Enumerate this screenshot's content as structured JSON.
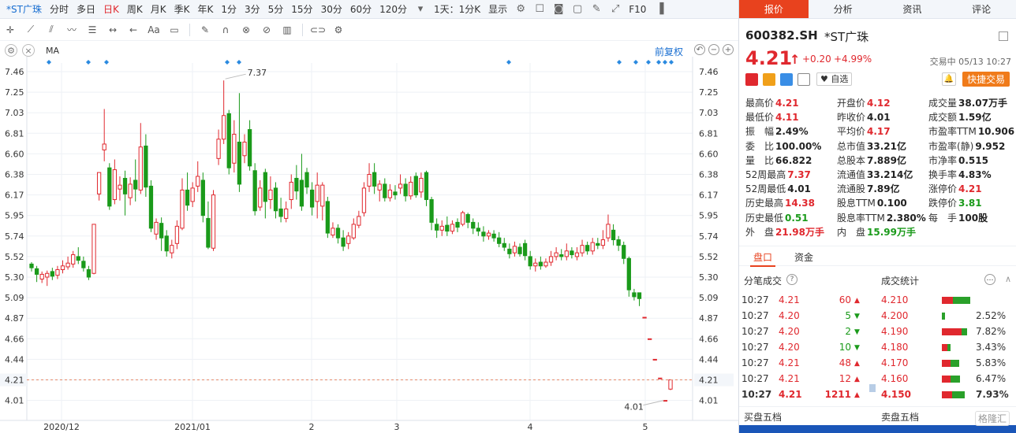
{
  "toolbar": {
    "stock": "*ST广珠",
    "periods": [
      "分时",
      "多日",
      "日K",
      "周K",
      "月K",
      "季K",
      "年K",
      "1分",
      "3分",
      "5分",
      "15分",
      "30分",
      "60分",
      "120分"
    ],
    "active_period": "日K",
    "multi": "1天：1分K",
    "display": "显示",
    "right_label": "F10"
  },
  "drawbar": {
    "ma_label": "MA",
    "adjust": "前复权",
    "text_tool": "Aa"
  },
  "chart_data": {
    "type": "candlestick",
    "y_ticks": [
      7.46,
      7.25,
      7.03,
      6.81,
      6.6,
      6.38,
      6.17,
      5.95,
      5.74,
      5.52,
      5.3,
      5.09,
      4.87,
      4.66,
      4.44,
      4.21,
      4.01
    ],
    "x_labels": [
      "2020/12",
      "2021/01",
      "2",
      "3",
      "4",
      "5"
    ],
    "current_price": "4.21",
    "high_label": "7.37",
    "low_label": "4.01",
    "ylim": [
      3.95,
      7.5
    ],
    "candles": [
      [
        5.44,
        5.4,
        5.46,
        5.36
      ],
      [
        5.39,
        5.33,
        5.42,
        5.25
      ],
      [
        5.28,
        5.33,
        5.36,
        5.24
      ],
      [
        5.3,
        5.34,
        5.37,
        5.21
      ],
      [
        5.36,
        5.31,
        5.4,
        5.27
      ],
      [
        5.32,
        5.38,
        5.42,
        5.28
      ],
      [
        5.38,
        5.42,
        5.48,
        5.34
      ],
      [
        5.41,
        5.45,
        5.52,
        5.38
      ],
      [
        5.44,
        5.54,
        5.58,
        5.4
      ],
      [
        5.52,
        5.48,
        5.62,
        5.44
      ],
      [
        5.47,
        5.4,
        5.52,
        5.36
      ],
      [
        5.38,
        5.3,
        5.42,
        5.27
      ],
      [
        5.34,
        5.86,
        5.86,
        5.33
      ],
      [
        6.18,
        6.4,
        6.4,
        6.11
      ],
      [
        6.64,
        6.7,
        7.07,
        6.52
      ],
      [
        6.45,
        6.05,
        6.5,
        6.01
      ],
      [
        6.12,
        6.43,
        6.54,
        6.07
      ],
      [
        6.23,
        6.27,
        6.36,
        6.11
      ],
      [
        6.34,
        6.18,
        6.42,
        5.95
      ],
      [
        6.14,
        6.28,
        6.35,
        6.06
      ],
      [
        6.32,
        6.23,
        6.54,
        6.1
      ],
      [
        6.22,
        6.67,
        6.92,
        6.18
      ],
      [
        6.68,
        6.25,
        6.8,
        6.15
      ],
      [
        6.26,
        5.82,
        6.32,
        5.78
      ],
      [
        5.76,
        5.88,
        5.92,
        5.7
      ],
      [
        5.87,
        5.72,
        5.93,
        5.58
      ],
      [
        5.74,
        5.58,
        5.8,
        5.52
      ],
      [
        5.56,
        5.64,
        5.7,
        5.5
      ],
      [
        5.66,
        5.84,
        5.9,
        5.6
      ],
      [
        5.82,
        6.22,
        6.34,
        5.8
      ],
      [
        6.22,
        6.06,
        6.4,
        6.0
      ],
      [
        6.1,
        6.24,
        6.3,
        6.04
      ],
      [
        6.26,
        6.36,
        6.52,
        6.2
      ],
      [
        6.32,
        5.95,
        6.4,
        5.88
      ],
      [
        5.92,
        5.62,
        6.1,
        5.6
      ],
      [
        5.61,
        6.17,
        6.22,
        5.58
      ],
      [
        6.55,
        6.75,
        6.85,
        6.48
      ],
      [
        6.75,
        7.0,
        7.37,
        6.7
      ],
      [
        7.02,
        6.45,
        7.06,
        6.38
      ],
      [
        6.5,
        6.8,
        6.95,
        6.4
      ],
      [
        6.72,
        6.28,
        7.24,
        6.2
      ],
      [
        6.58,
        6.72,
        6.8,
        6.5
      ],
      [
        6.85,
        6.47,
        6.95,
        6.42
      ],
      [
        6.42,
        6.0,
        6.5,
        5.95
      ],
      [
        6.04,
        6.24,
        6.32,
        6.0
      ],
      [
        6.4,
        6.1,
        6.44,
        5.92
      ],
      [
        6.12,
        6.22,
        6.36,
        6.02
      ],
      [
        6.24,
        6.0,
        6.3,
        5.92
      ],
      [
        6.02,
        5.94,
        6.14,
        5.88
      ],
      [
        5.92,
        6.02,
        6.1,
        5.88
      ],
      [
        6.12,
        6.3,
        6.38,
        6.02
      ],
      [
        6.34,
        6.21,
        6.48,
        6.12
      ],
      [
        6.32,
        6.05,
        6.6,
        6.0
      ],
      [
        6.4,
        6.25,
        6.45,
        6.18
      ],
      [
        6.22,
        6.04,
        6.3,
        5.95
      ],
      [
        6.1,
        6.27,
        6.4,
        5.92
      ],
      [
        6.05,
        6.27,
        6.3,
        5.9
      ],
      [
        6.1,
        5.77,
        6.15,
        5.72
      ],
      [
        5.75,
        5.82,
        5.88,
        5.72
      ],
      [
        5.82,
        5.72,
        5.86,
        5.66
      ],
      [
        5.72,
        5.63,
        5.8,
        5.58
      ],
      [
        5.66,
        5.74,
        5.78,
        5.6
      ],
      [
        5.72,
        5.86,
        5.92,
        5.7
      ],
      [
        5.85,
        5.94,
        6.0,
        5.82
      ],
      [
        5.98,
        6.24,
        6.3,
        5.94
      ],
      [
        6.26,
        6.38,
        6.5,
        6.2
      ],
      [
        6.4,
        6.26,
        6.5,
        6.18
      ],
      [
        6.22,
        6.28,
        6.32,
        6.1
      ],
      [
        6.28,
        6.14,
        6.34,
        6.1
      ],
      [
        6.14,
        6.22,
        6.28,
        6.1
      ],
      [
        6.2,
        6.17,
        6.27,
        6.12
      ],
      [
        6.24,
        6.28,
        6.38,
        6.18
      ],
      [
        6.28,
        6.16,
        6.34,
        6.1
      ],
      [
        6.16,
        6.3,
        6.36,
        6.12
      ],
      [
        6.36,
        6.17,
        6.4,
        6.14
      ],
      [
        6.2,
        6.34,
        6.4,
        6.14
      ],
      [
        6.4,
        6.12,
        6.42,
        6.05
      ],
      [
        6.12,
        5.88,
        6.15,
        5.8
      ],
      [
        5.86,
        5.8,
        5.92,
        5.72
      ],
      [
        5.8,
        5.84,
        5.9,
        5.74
      ],
      [
        5.85,
        5.79,
        5.94,
        5.74
      ],
      [
        5.79,
        5.86,
        5.9,
        5.76
      ],
      [
        5.88,
        5.83,
        5.92,
        5.78
      ],
      [
        5.86,
        5.98,
        6.0,
        5.84
      ],
      [
        5.96,
        5.88,
        5.98,
        5.82
      ],
      [
        5.88,
        5.82,
        5.92,
        5.76
      ],
      [
        5.82,
        5.79,
        5.88,
        5.74
      ],
      [
        5.78,
        5.74,
        5.84,
        5.68
      ],
      [
        5.74,
        5.77,
        5.8,
        5.7
      ],
      [
        5.76,
        5.72,
        5.8,
        5.68
      ],
      [
        5.72,
        5.66,
        5.78,
        5.62
      ],
      [
        5.66,
        5.62,
        5.72,
        5.58
      ],
      [
        5.6,
        5.55,
        5.66,
        5.5
      ],
      [
        5.56,
        5.63,
        5.68,
        5.52
      ],
      [
        5.62,
        5.55,
        5.66,
        5.52
      ],
      [
        5.66,
        5.53,
        5.7,
        5.48
      ],
      [
        5.52,
        5.42,
        5.58,
        5.38
      ],
      [
        5.42,
        5.45,
        5.5,
        5.36
      ],
      [
        5.46,
        5.42,
        5.52,
        5.38
      ],
      [
        5.42,
        5.46,
        5.5,
        5.4
      ],
      [
        5.46,
        5.52,
        5.58,
        5.42
      ],
      [
        5.52,
        5.56,
        5.62,
        5.48
      ],
      [
        5.54,
        5.52,
        5.6,
        5.48
      ],
      [
        5.52,
        5.58,
        5.66,
        5.48
      ],
      [
        5.58,
        5.54,
        5.62,
        5.5
      ],
      [
        5.52,
        5.56,
        5.62,
        5.48
      ],
      [
        5.56,
        5.64,
        5.7,
        5.52
      ],
      [
        5.64,
        5.58,
        5.68,
        5.54
      ],
      [
        5.58,
        5.67,
        5.72,
        5.54
      ],
      [
        5.66,
        5.64,
        5.72,
        5.6
      ],
      [
        5.64,
        5.7,
        5.8,
        5.6
      ],
      [
        5.72,
        5.86,
        5.96,
        5.68
      ],
      [
        5.8,
        5.7,
        5.86,
        5.64
      ],
      [
        5.7,
        5.64,
        5.74,
        5.58
      ],
      [
        5.64,
        5.5,
        5.68,
        5.44
      ],
      [
        5.5,
        5.17,
        5.52,
        5.1
      ],
      [
        5.14,
        5.1,
        5.18,
        5.06
      ],
      [
        5.14,
        5.08,
        5.14,
        5.0
      ],
      [
        4.88,
        4.88,
        4.88,
        4.88
      ],
      [
        4.66,
        4.66,
        4.66,
        4.66
      ],
      [
        4.44,
        4.44,
        4.44,
        4.44
      ],
      [
        4.23,
        4.23,
        4.23,
        4.23
      ],
      [
        4.01,
        4.01,
        4.01,
        4.01
      ],
      [
        4.12,
        4.21,
        4.21,
        4.11
      ]
    ]
  },
  "quote": {
    "code": "600382.SH",
    "name": "*ST广珠",
    "price": "4.21",
    "change": "+0.20",
    "change_pct": "+4.99%",
    "trade_status": "交易中 05/13 10:27",
    "fav_label": "自选",
    "fast_trade": "快捷交易"
  },
  "tabs": [
    "报价",
    "分析",
    "资讯",
    "评论"
  ],
  "stats": [
    [
      {
        "l": "最高价",
        "v": "4.21",
        "c": "red"
      },
      {
        "l": "开盘价",
        "v": "4.12",
        "c": "red"
      },
      {
        "l": "成交量",
        "v": "38.07万手",
        "c": "dark"
      }
    ],
    [
      {
        "l": "最低价",
        "v": "4.11",
        "c": "red"
      },
      {
        "l": "昨收价",
        "v": "4.01",
        "c": "dark"
      },
      {
        "l": "成交额",
        "v": "1.59亿",
        "c": "dark"
      }
    ],
    [
      {
        "l": "振　幅",
        "v": "2.49%",
        "c": "dark"
      },
      {
        "l": "平均价",
        "v": "4.17",
        "c": "red"
      },
      {
        "l": "市盈率TTM",
        "v": "10.906",
        "c": "dark"
      }
    ],
    [
      {
        "l": "委　比",
        "v": "100.00%",
        "c": "dark"
      },
      {
        "l": "总市值",
        "v": "33.21亿",
        "c": "dark"
      },
      {
        "l": "市盈率(静)",
        "v": "9.952",
        "c": "dark"
      }
    ],
    [
      {
        "l": "量　比",
        "v": "66.822",
        "c": "dark"
      },
      {
        "l": "总股本",
        "v": "7.889亿",
        "c": "dark"
      },
      {
        "l": "市净率",
        "v": "0.515",
        "c": "dark"
      }
    ],
    [
      {
        "l": "52周最高",
        "v": "7.37",
        "c": "red"
      },
      {
        "l": "流通值",
        "v": "33.214亿",
        "c": "dark"
      },
      {
        "l": "换手率",
        "v": "4.83%",
        "c": "dark"
      }
    ],
    [
      {
        "l": "52周最低",
        "v": "4.01",
        "c": "dark"
      },
      {
        "l": "流通股",
        "v": "7.89亿",
        "c": "dark"
      },
      {
        "l": "涨停价",
        "v": "4.21",
        "c": "red"
      }
    ],
    [
      {
        "l": "历史最高",
        "v": "14.38",
        "c": "red"
      },
      {
        "l": "股息TTM",
        "v": "0.100",
        "c": "dark"
      },
      {
        "l": "跌停价",
        "v": "3.81",
        "c": "green"
      }
    ],
    [
      {
        "l": "历史最低",
        "v": "0.51",
        "c": "green"
      },
      {
        "l": "股息率TTM",
        "v": "2.380%",
        "c": "dark"
      },
      {
        "l": "每　手",
        "v": "100股",
        "c": "dark"
      }
    ],
    [
      {
        "l": "外　盘",
        "v": "21.98万手",
        "c": "red"
      },
      {
        "l": "内　盘",
        "v": "15.99万手",
        "c": "green"
      },
      {
        "l": "",
        "v": "",
        "c": "dark"
      }
    ]
  ],
  "subtabs": [
    "盘口",
    "资金"
  ],
  "tick_header": "分笔成交",
  "stat_header": "成交统计",
  "trades": [
    {
      "t": "10:27",
      "p": "4.21",
      "pc": "red",
      "v": "60",
      "dir": "up",
      "bp": "4.210",
      "pct": "",
      "r": 0.4,
      "g": 0.6
    },
    {
      "t": "10:27",
      "p": "4.20",
      "pc": "red",
      "v": "5",
      "dir": "down",
      "bp": "4.200",
      "pct": "2.52%",
      "r": 0,
      "g": 0.1
    },
    {
      "t": "10:27",
      "p": "4.20",
      "pc": "red",
      "v": "2",
      "dir": "down",
      "bp": "4.190",
      "pct": "7.82%",
      "r": 0.7,
      "g": 0.2
    },
    {
      "t": "10:27",
      "p": "4.20",
      "pc": "red",
      "v": "10",
      "dir": "down",
      "bp": "4.180",
      "pct": "3.43%",
      "r": 0.2,
      "g": 0.1
    },
    {
      "t": "10:27",
      "p": "4.21",
      "pc": "red",
      "v": "48",
      "dir": "up",
      "bp": "4.170",
      "pct": "5.83%",
      "r": 0.3,
      "g": 0.3
    },
    {
      "t": "10:27",
      "p": "4.21",
      "pc": "red",
      "v": "12",
      "dir": "up",
      "bp": "4.160",
      "pct": "6.47%",
      "r": 0.3,
      "g": 0.35
    },
    {
      "t": "10:27",
      "p": "4.21",
      "pc": "red",
      "v": "1211",
      "dir": "up",
      "bp": "4.150",
      "pct": "7.93%",
      "r": 0.35,
      "g": 0.45
    }
  ],
  "bottom": {
    "buy5": "买盘五档",
    "sell5": "卖盘五档",
    "watermark": "格隆汇"
  }
}
